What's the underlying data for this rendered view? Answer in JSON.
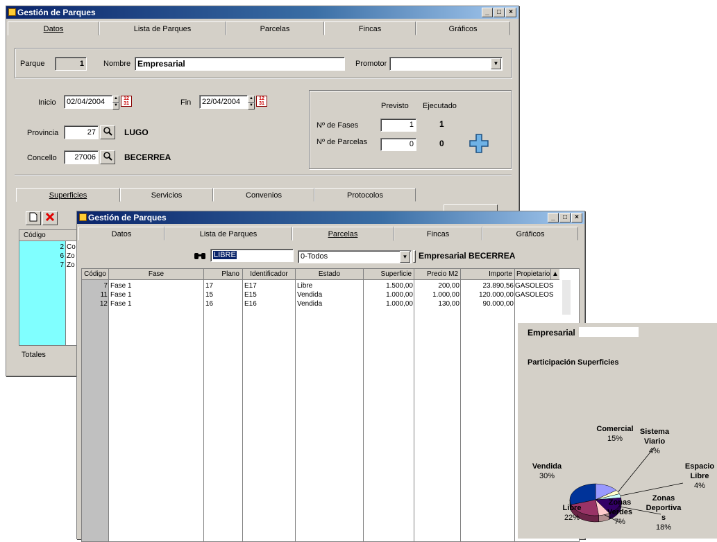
{
  "window1": {
    "title": "Gestión de Parques",
    "tabs": [
      "Datos",
      "Lista de Parques",
      "Parcelas",
      "Fincas",
      "Gráficos"
    ],
    "parque_label": "Parque",
    "parque_value": "1",
    "nombre_label": "Nombre",
    "nombre_value": "Empresarial",
    "promotor_label": "Promotor",
    "promotor_value": "",
    "inicio_label": "Inicio",
    "inicio_value": "02/04/2004",
    "fin_label": "Fin",
    "fin_value": "22/04/2004",
    "provincia_label": "Provincia",
    "provincia_value": "27",
    "provincia_name": "LUGO",
    "concello_label": "Concello",
    "concello_value": "27006",
    "concello_name": "BECERREA",
    "previsto_label": "Previsto",
    "ejecutado_label": "Ejecutado",
    "fases_label": "Nº de Fases",
    "fases_previsto": "1",
    "fases_ejecutado": "1",
    "parcelas_label": "Nº de Parcelas",
    "parcelas_previsto": "0",
    "parcelas_ejecutado": "0",
    "subtabs": [
      "Superficies",
      "Servicios",
      "Convenios",
      "Protocolos"
    ],
    "codigo_header": "Código",
    "rows": [
      {
        "code": "2",
        "name": "Co"
      },
      {
        "code": "6",
        "name": "Zo"
      },
      {
        "code": "7",
        "name": "Zo"
      }
    ],
    "totales_label": "Totales"
  },
  "window2": {
    "title": "Gestión de Parques",
    "tabs": [
      "Datos",
      "Lista de Parques",
      "Parcelas",
      "Fincas",
      "Gráficos"
    ],
    "search_value": "LIBRE",
    "filter_value": "0-Todos",
    "park_label": "Empresarial BECERREA",
    "columns": [
      "Código",
      "Fase",
      "Plano",
      "Identificador",
      "Estado",
      "Superficie",
      "Precio M2",
      "Importe",
      "Propietario"
    ],
    "rows": [
      [
        "7",
        "Fase 1",
        "17",
        "E17",
        "Libre",
        "1.500,00",
        "200,00",
        "23.890,56",
        "GASOLEOS"
      ],
      [
        "11",
        "Fase 1",
        "15",
        "E15",
        "Vendida",
        "1.000,00",
        "1.000,00",
        "120.000,00",
        "GASOLEOS"
      ],
      [
        "12",
        "Fase 1",
        "16",
        "E16",
        "Vendida",
        "1.000,00",
        "130,00",
        "90.000,00",
        ""
      ]
    ]
  },
  "chart_panel": {
    "park_name": "Empresarial",
    "title": "Participación Superficies"
  },
  "chart_data": {
    "type": "pie",
    "title": "Participación Superficies",
    "categories": [
      "Comercial",
      "Sistema Viario",
      "Espacio Libre",
      "Zonas Deportivas",
      "Zonas Verdes",
      "Libre",
      "Vendida"
    ],
    "values": [
      15,
      4,
      4,
      18,
      7,
      22,
      30
    ],
    "label_lines": [
      [
        "Comercial",
        "15%"
      ],
      [
        "Sistema",
        "Viario",
        "4%"
      ],
      [
        "Espacio",
        "Libre",
        "4%"
      ],
      [
        "Zonas",
        "Deportiva",
        "s",
        "18%"
      ],
      [
        "Zonas",
        "Verdes",
        "7%"
      ],
      [
        "Libre",
        "22%"
      ],
      [
        "Vendida",
        "30%"
      ]
    ],
    "colors": [
      "#9999ff",
      "#ffffcc",
      "#ccffff",
      "#330066",
      "#ffcccc",
      "#993366",
      "#003399"
    ]
  }
}
